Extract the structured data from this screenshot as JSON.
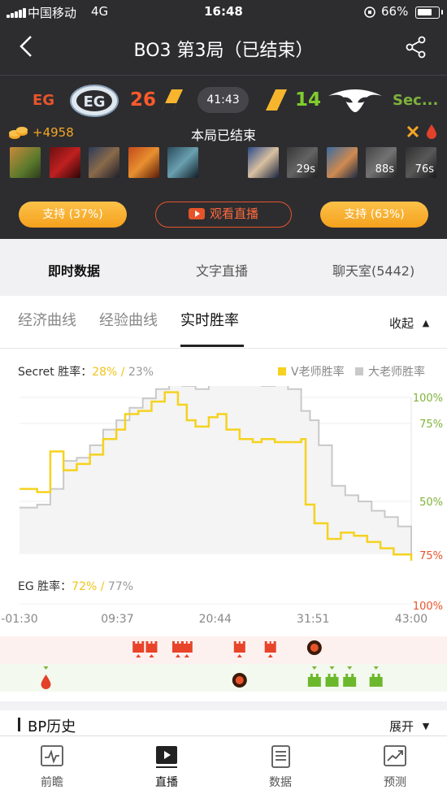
{
  "status_bar": {
    "carrier": "中国移动",
    "network": "4G",
    "time": "16:48",
    "battery": "66%"
  },
  "header": {
    "title": "BO3   第3局（已结束）"
  },
  "match": {
    "team_left": "EG",
    "score_left": "26",
    "clock": "41:43",
    "score_right": "14",
    "team_right": "Sec...",
    "gold_lead": "+4958",
    "status": "本局已结束",
    "respawn_timers": [
      "29s",
      "88s",
      "76s"
    ],
    "support_left": "支持 (37%)",
    "live_label": "观看直播",
    "support_right": "支持 (63%)"
  },
  "tabs": {
    "items": [
      "即时数据",
      "文字直播",
      "聊天室(5442)"
    ],
    "active": 0
  },
  "subtabs": {
    "items": [
      "经济曲线",
      "经验曲线",
      "实时胜率"
    ],
    "active": 2,
    "collapse_label": "收起"
  },
  "winrate": {
    "secret_label": "Secret 胜率：",
    "secret_v": "28%",
    "secret_big": "23%",
    "eg_label": "EG 胜率：",
    "eg_v": "72%",
    "eg_big": "77%",
    "legend_v": "V老师胜率",
    "legend_big": "大老师胜率"
  },
  "bp": {
    "title": "BP历史",
    "expand_label": "展开"
  },
  "bottom_nav": {
    "items": [
      "前瞻",
      "直播",
      "数据",
      "预测"
    ],
    "active": 1
  },
  "colors": {
    "accent_orange": "#f5a623",
    "v_line": "#f5d21f",
    "big_line": "#c9c9c9",
    "eg_red": "#e8542a",
    "secret_green": "#7fb23a"
  },
  "chart_data": {
    "type": "line",
    "x_tick_labels": [
      "-01:30",
      "09:37",
      "20:44",
      "31:51",
      "43:00"
    ],
    "xlim_minutes": [
      -1.5,
      43.0
    ],
    "right_axis_labels_top_half": [
      "100%",
      "75%",
      "50%"
    ],
    "right_axis_labels_bottom_half": [
      "75%",
      "100%"
    ],
    "y_meaning": "Secret win probability (%)",
    "series": [
      {
        "name": "V老师胜率",
        "x_minutes": [
          -1.5,
          0.5,
          2.0,
          3.5,
          5.0,
          6.5,
          8.0,
          9.5,
          10.5,
          12.0,
          13.5,
          15.0,
          16.5,
          17.5,
          18.5,
          20.0,
          21.0,
          22.0,
          23.5,
          25.0,
          26.0,
          27.5,
          29.0,
          30.5,
          31.0,
          32.0,
          33.5,
          35.0,
          36.5,
          38.0,
          39.5,
          41.0,
          43.0
        ],
        "values": [
          54,
          53,
          66,
          60,
          62,
          65,
          70,
          73,
          78,
          79,
          82,
          85,
          81,
          76,
          74,
          77,
          78,
          73,
          70,
          69,
          70,
          69,
          69,
          70,
          49,
          43,
          38,
          40,
          39,
          37,
          35,
          33,
          31
        ]
      },
      {
        "name": "大老师胜率",
        "x_minutes": [
          -1.5,
          0.5,
          2.0,
          3.5,
          5.0,
          6.5,
          8.0,
          9.5,
          11.0,
          12.5,
          14.0,
          15.5,
          17.0,
          18.5,
          20.0,
          21.5,
          23.0,
          24.5,
          26.0,
          27.5,
          29.0,
          30.5,
          31.5,
          32.5,
          34.0,
          35.5,
          37.0,
          38.5,
          40.0,
          41.5,
          43.0
        ],
        "values": [
          48,
          49,
          54,
          63,
          64,
          68,
          73,
          76,
          80,
          83,
          86,
          90,
          87,
          86,
          88,
          88,
          90,
          89,
          87,
          88,
          86,
          79,
          76,
          68,
          55,
          52,
          50,
          47,
          45,
          42,
          32
        ]
      }
    ],
    "events": {
      "eg_tower_kills_minutes": [
        12.0,
        13.5,
        16.5,
        17.5,
        23.5,
        27.0
      ],
      "eg_roshan_minutes": [
        32.0
      ],
      "secret_first_blood_minutes": [
        1.5
      ],
      "secret_roshan_minutes": [
        23.5
      ],
      "secret_barracks_minutes": [
        32.0,
        34.0,
        36.0,
        39.0
      ]
    },
    "grid": true
  }
}
